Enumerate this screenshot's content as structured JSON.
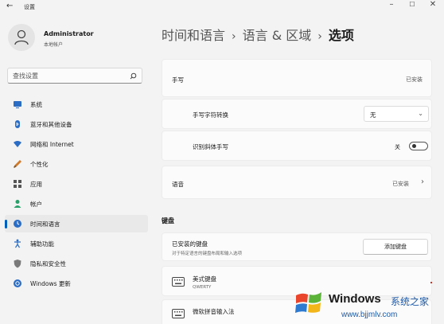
{
  "window": {
    "title": "设置",
    "back_glyph": "←",
    "minimize_glyph": "–",
    "maximize_glyph": "☐",
    "close_glyph": "✕"
  },
  "profile": {
    "name": "Administrator",
    "account_type": "本地帐户"
  },
  "search": {
    "placeholder": "查找设置"
  },
  "sidebar": {
    "items": [
      {
        "label": "系统",
        "icon": "monitor-icon",
        "color": "#2b6cc4"
      },
      {
        "label": "蓝牙和其他设备",
        "icon": "bluetooth-icon",
        "color": "#2b6cc4"
      },
      {
        "label": "网络和 Internet",
        "icon": "wifi-icon",
        "color": "#2b6cc4"
      },
      {
        "label": "个性化",
        "icon": "brush-icon",
        "color": "#d07a2b"
      },
      {
        "label": "应用",
        "icon": "apps-icon",
        "color": "#555555"
      },
      {
        "label": "帐户",
        "icon": "person-icon",
        "color": "#2aa06b"
      },
      {
        "label": "时间和语言",
        "icon": "globe-clock-icon",
        "color": "#2b6cc4",
        "active": true
      },
      {
        "label": "辅助功能",
        "icon": "accessibility-icon",
        "color": "#2b6cc4"
      },
      {
        "label": "隐私和安全性",
        "icon": "shield-icon",
        "color": "#7a7a7a"
      },
      {
        "label": "Windows 更新",
        "icon": "update-icon",
        "color": "#2b6cc4"
      }
    ]
  },
  "breadcrumb": {
    "part1": "时间和语言",
    "part2": "语言 & 区域",
    "current": "选项",
    "separator": "›"
  },
  "handwriting": {
    "label": "手写",
    "status": "已安装",
    "font_label": "手写字符转换",
    "font_value": "无",
    "italic_label": "识别斜体手写",
    "italic_state": "关"
  },
  "speech": {
    "label": "语音",
    "status": "已安装",
    "chevron": "›"
  },
  "keyboards": {
    "section_title": "键盘",
    "installed_label": "已安装的键盘",
    "installed_desc": "对于特定语言的键盘布局和输入选项",
    "add_button": "添加键盘",
    "items": [
      {
        "name": "美式键盘",
        "layout": "QWERTY"
      },
      {
        "name": "微软拼音输入法",
        "layout": ""
      }
    ]
  },
  "watermark": {
    "brand": "Windows",
    "brand_cn": "系统之家",
    "url": "www.bjjmlv.com"
  },
  "colors": {
    "accent": "#005fb8",
    "background": "#f3f3f3",
    "card": "#fbfbfb"
  }
}
